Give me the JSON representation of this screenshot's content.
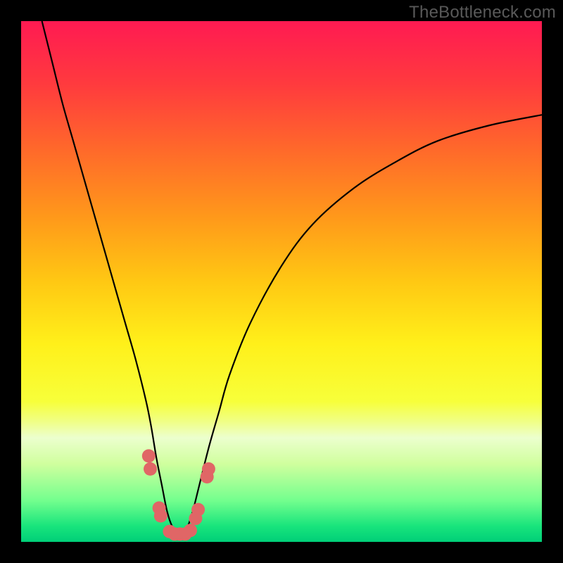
{
  "watermark": "TheBottleneck.com",
  "chart_data": {
    "type": "line",
    "title": "",
    "xlabel": "",
    "ylabel": "",
    "xlim": [
      0,
      100
    ],
    "ylim": [
      0,
      100
    ],
    "background_gradient": {
      "top_color": "#ff1a52",
      "mid_color": "#fff01a",
      "bottom_color": "#00cf78",
      "meaning": "bottleneck percentage (red=high, green=low)"
    },
    "series": [
      {
        "name": "bottleneck-curve",
        "x": [
          4,
          6,
          8,
          10,
          12,
          14,
          16,
          18,
          20,
          22,
          24,
          25,
          26,
          27,
          28,
          29,
          30,
          31,
          32,
          33,
          34,
          36,
          38,
          40,
          44,
          50,
          56,
          64,
          72,
          80,
          90,
          100
        ],
        "values": [
          100,
          92,
          84,
          77,
          70,
          63,
          56,
          49,
          42,
          35,
          27,
          22,
          16,
          11,
          6,
          3,
          2,
          2,
          3,
          6,
          10,
          18,
          25,
          32,
          42,
          53,
          61,
          68,
          73,
          77,
          80,
          82
        ]
      }
    ],
    "markers": {
      "name": "highlighted-points",
      "color": "#e06666",
      "points": [
        {
          "x": 24.5,
          "y": 16.5
        },
        {
          "x": 24.8,
          "y": 14.0
        },
        {
          "x": 26.5,
          "y": 6.5
        },
        {
          "x": 26.8,
          "y": 5.0
        },
        {
          "x": 28.5,
          "y": 2.0
        },
        {
          "x": 29.5,
          "y": 1.5
        },
        {
          "x": 30.5,
          "y": 1.5
        },
        {
          "x": 31.5,
          "y": 1.5
        },
        {
          "x": 32.5,
          "y": 2.2
        },
        {
          "x": 33.5,
          "y": 4.5
        },
        {
          "x": 34.0,
          "y": 6.2
        },
        {
          "x": 35.7,
          "y": 12.5
        },
        {
          "x": 36.0,
          "y": 14.0
        }
      ]
    }
  }
}
